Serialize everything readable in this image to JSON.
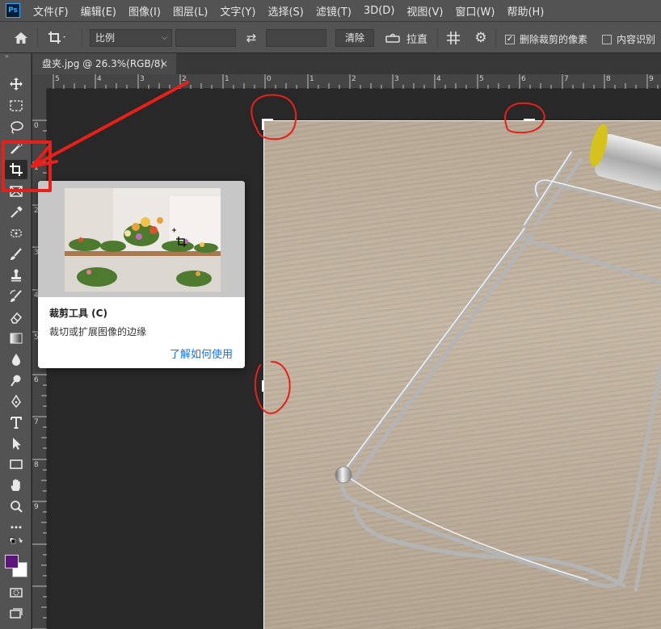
{
  "app": {
    "logo_text": "Ps"
  },
  "menu": [
    "文件(F)",
    "编辑(E)",
    "图像(I)",
    "图层(L)",
    "文字(Y)",
    "选择(S)",
    "滤镜(T)",
    "3D(D)",
    "视图(V)",
    "窗口(W)",
    "帮助(H)"
  ],
  "options_bar": {
    "ratio_value": "比例",
    "width_value": "",
    "height_value": "",
    "clear_label": "清除",
    "straighten_label": "拉直",
    "delete_cropped_label": "删除裁剪的像素",
    "delete_cropped_checked": true,
    "content_aware_label": "内容识别",
    "content_aware_checked": false
  },
  "document_tab": {
    "title": "盘夹.jpg @ 26.3%(RGB/8)",
    "close": "×"
  },
  "rulers": {
    "horizontal": [
      "5",
      "4",
      "3",
      "2",
      "1",
      "0",
      "1",
      "2",
      "3",
      "4",
      "5",
      "6",
      "7",
      "8",
      "9"
    ],
    "vertical": [
      "0",
      "1",
      "2",
      "3",
      "4",
      "5",
      "6",
      "7",
      "8",
      "9"
    ]
  },
  "tooltip": {
    "title": "裁剪工具 (C)",
    "description": "裁切或扩展图像的边缘",
    "link": "了解如何使用"
  },
  "colors": {
    "foreground": "#5b157c",
    "background": "#ffffff",
    "annotation": "#e8201a",
    "link": "#1473e6"
  }
}
